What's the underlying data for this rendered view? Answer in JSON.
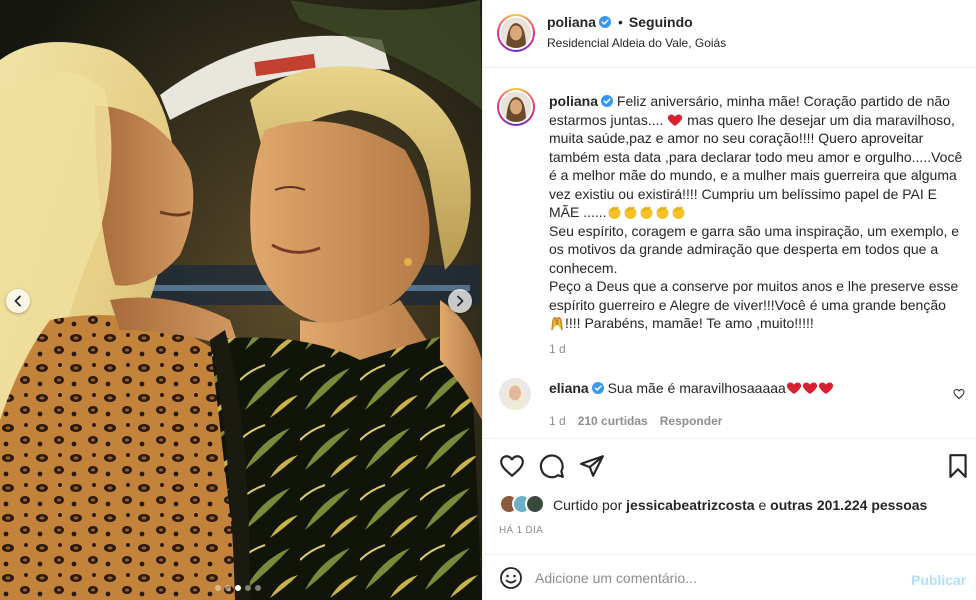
{
  "post": {
    "author": "poliana",
    "location": "Residencial Aldeia do Vale, Goiás",
    "follow_label": "Seguindo",
    "separator": "•",
    "carousel": {
      "slides": 5,
      "active_index": 2
    }
  },
  "caption": {
    "author": "poliana",
    "p1_a": "Feliz aniversário, minha mãe! Coração partido de não estarmos juntas.... ",
    "p1_b": " mas quero lhe desejar um dia maravilhoso, muita saúde,paz e amor no seu coração!!!! Quero aproveitar também esta data ,para declarar todo meu amor e orgulho.....Você é a melhor mãe do mundo, e a mulher mais guerreira que alguma vez existiu ou existirá!!!! Cumpriu um belíssimo papel de PAI E MÃE ......",
    "p2": "Seu espírito, coragem e garra são uma inspiração, um exemplo, e os motivos da grande admiração que desperta em todos que a conhecem.",
    "p3_a": "Peço a Deus que a conserve por muitos anos e lhe preserve esse espírito guerreiro e Alegre de viver!!!Você é uma grande benção ",
    "p3_b": "!!!! Parabéns, mamãe! Te amo ,muito!!!!!",
    "time": "1 d"
  },
  "comments": [
    {
      "author": "eliana",
      "text": "Sua mãe é maravilhosaaaaa",
      "time": "1 d",
      "likes": "210 curtidas",
      "reply_label": "Responder"
    }
  ],
  "likes": {
    "prefix": "Curtido por",
    "user": "jessicabeatrizcosta",
    "connector": "e",
    "others": "outras 201.224 pessoas"
  },
  "date_label": "HÁ 1 DIA",
  "comment_box": {
    "placeholder": "Adicione um comentário...",
    "publish_label": "Publicar"
  },
  "icons": {
    "verified": "verified-badge-icon",
    "like": "heart-outline-icon",
    "comment": "comment-bubble-icon",
    "share": "paper-plane-icon",
    "save": "bookmark-icon",
    "emoji": "smiley-icon",
    "prev": "chevron-left-icon",
    "next": "chevron-right-icon"
  },
  "colors": {
    "verified": "#3897f0",
    "heart_emoji": "#d8202f",
    "publish_disabled": "#b2dffc",
    "muted_text": "#8e8e8e"
  }
}
